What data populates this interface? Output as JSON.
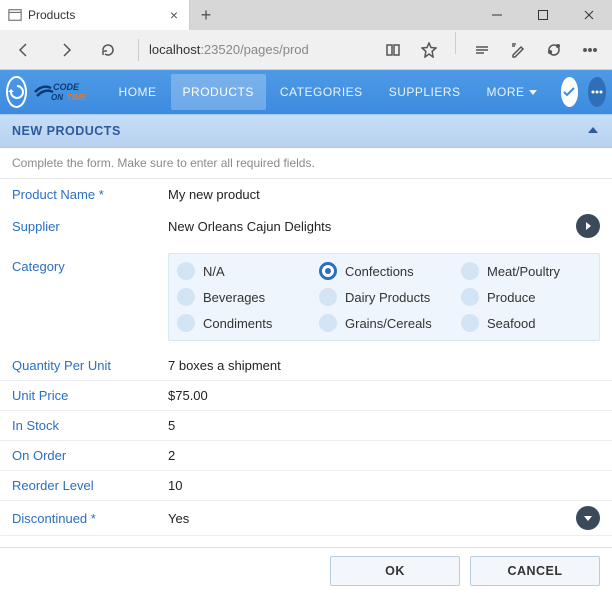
{
  "browser": {
    "tab_title": "Products",
    "url_host": "localhost",
    "url_path": ":23520/pages/prod"
  },
  "nav": {
    "items": [
      "HOME",
      "PRODUCTS",
      "CATEGORIES",
      "SUPPLIERS",
      "MORE"
    ],
    "active_index": 1
  },
  "section": {
    "title": "NEW PRODUCTS"
  },
  "hint": "Complete the form. Make sure to enter all required fields.",
  "form": {
    "product_name": {
      "label": "Product Name *",
      "value": "My new product"
    },
    "supplier": {
      "label": "Supplier",
      "value": "New Orleans Cajun Delights"
    },
    "category": {
      "label": "Category",
      "options": [
        "N/A",
        "Confections",
        "Meat/Poultry",
        "Beverages",
        "Dairy Products",
        "Produce",
        "Condiments",
        "Grains/Cereals",
        "Seafood"
      ],
      "selected": "Confections"
    },
    "qpu": {
      "label": "Quantity Per Unit",
      "value": "7 boxes a shipment"
    },
    "unit_price": {
      "label": "Unit Price",
      "value": "$75.00"
    },
    "in_stock": {
      "label": "In Stock",
      "value": "5"
    },
    "on_order": {
      "label": "On Order",
      "value": "2"
    },
    "reorder": {
      "label": "Reorder Level",
      "value": "10"
    },
    "discontinued": {
      "label": "Discontinued *",
      "value": "Yes"
    }
  },
  "footer": {
    "ok": "OK",
    "cancel": "CANCEL"
  }
}
